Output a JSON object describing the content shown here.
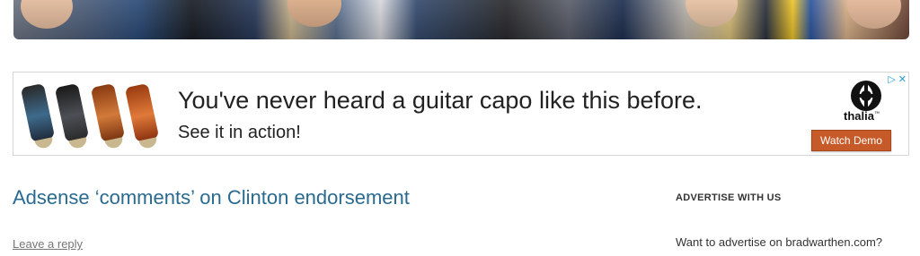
{
  "ad": {
    "headline": "You've never heard a guitar capo like this before.",
    "subline": "See it in action!",
    "brand": "thalia",
    "cta_label": "Watch Demo",
    "adchoices_icons": [
      "play-triangle-icon",
      "close-icon"
    ],
    "cta_color": "#c65a28"
  },
  "post": {
    "title": "Adsense ‘comments’ on Clinton endorsement",
    "reply_link": "Leave a reply"
  },
  "sidebar": {
    "widget_title": "ADVERTISE WITH US",
    "widget_text": "Want to advertise on bradwarthen.com?"
  },
  "colors": {
    "title_link": "#2b6a8f",
    "adchoices_blue": "#2a9fd6"
  }
}
